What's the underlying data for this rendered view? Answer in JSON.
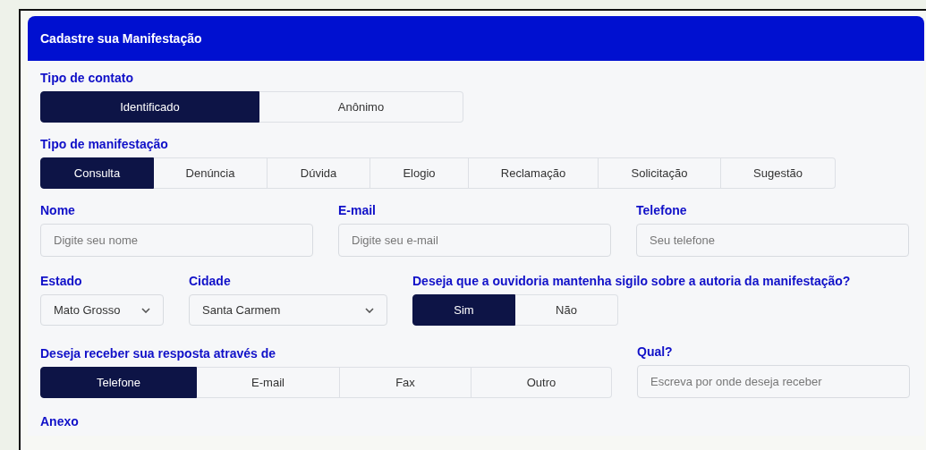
{
  "form": {
    "title": "Cadastre sua Manifestação"
  },
  "contact_type": {
    "label": "Tipo de contato",
    "options": [
      {
        "label": "Identificado",
        "selected": true
      },
      {
        "label": "Anônimo",
        "selected": false
      }
    ]
  },
  "manifestation_type": {
    "label": "Tipo de manifestação",
    "options": [
      {
        "label": "Consulta",
        "selected": true
      },
      {
        "label": "Denúncia",
        "selected": false
      },
      {
        "label": "Dúvida",
        "selected": false
      },
      {
        "label": "Elogio",
        "selected": false
      },
      {
        "label": "Reclamação",
        "selected": false
      },
      {
        "label": "Solicitação",
        "selected": false
      },
      {
        "label": "Sugestão",
        "selected": false
      }
    ]
  },
  "fields": [
    {
      "label": "Nome",
      "placeholder": "Digite seu nome"
    },
    {
      "label": "E-mail",
      "placeholder": "Digite seu e-mail"
    },
    {
      "label": "Telefone",
      "placeholder": "Seu telefone"
    }
  ],
  "state": {
    "label": "Estado",
    "value": "Mato Grosso"
  },
  "city": {
    "label": "Cidade",
    "value": "Santa Carmem"
  },
  "secrecy": {
    "label": "Deseja que a ouvidoria mantenha sigilo sobre a autoria da manifestação?",
    "options": [
      {
        "label": "Sim",
        "selected": true
      },
      {
        "label": "Não",
        "selected": false
      }
    ]
  },
  "reply_via": {
    "label": "Deseja receber sua resposta através de",
    "options": [
      {
        "label": "Telefone",
        "selected": true
      },
      {
        "label": "E-mail",
        "selected": false
      },
      {
        "label": "Fax",
        "selected": false
      },
      {
        "label": "Outro",
        "selected": false
      }
    ]
  },
  "which": {
    "label": "Qual?",
    "placeholder": "Escreva por onde deseja receber"
  },
  "attachment": {
    "label": "Anexo"
  }
}
